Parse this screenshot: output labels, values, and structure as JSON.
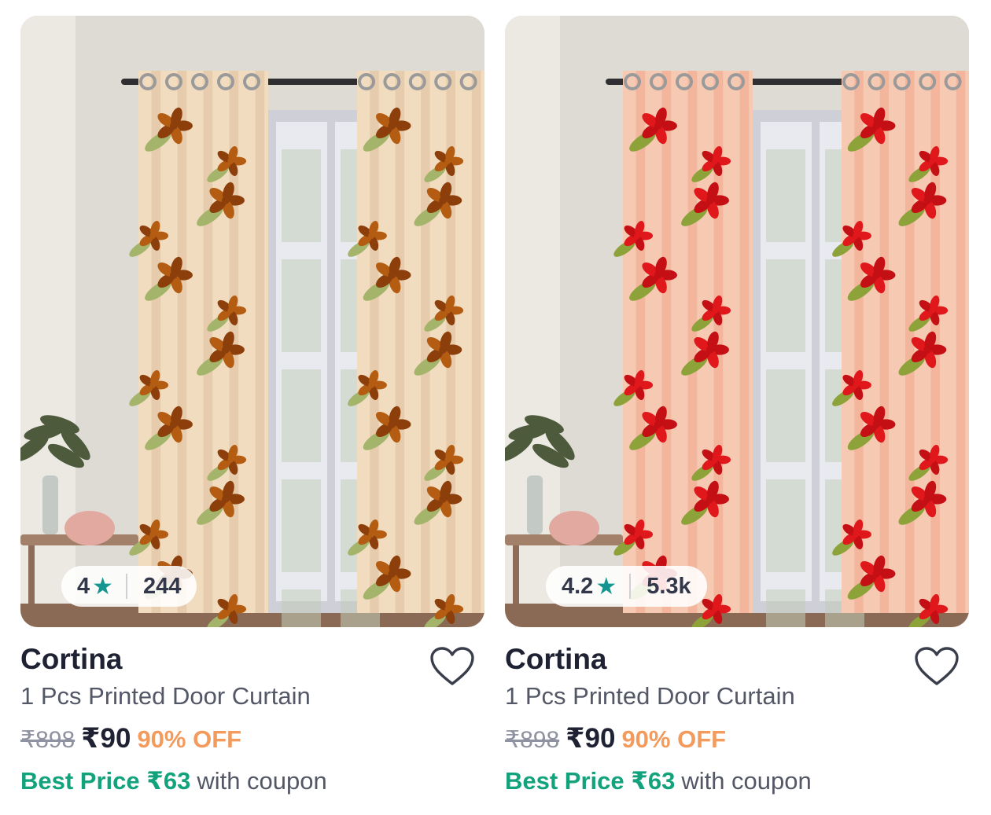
{
  "products": [
    {
      "rating": "4",
      "rating_count": "244",
      "brand": "Cortina",
      "title": "1 Pcs Printed Door Curtain",
      "mrp": "₹898",
      "price": "₹90",
      "discount": "90% OFF",
      "best_price_label": "Best Price ₹63",
      "best_price_suffix": "with coupon",
      "curtain_palette": {
        "base": "#f1dcc0",
        "shade": "#dcbf9a",
        "flower": "#b45d12",
        "flower2": "#8c3f0b",
        "leaf": "#a4b46a"
      },
      "wishlist_icon": "heart-outline-icon",
      "rating_icon": "star-icon"
    },
    {
      "rating": "4.2",
      "rating_count": "5.3k",
      "brand": "Cortina",
      "title": "1 Pcs Printed Door Curtain",
      "mrp": "₹898",
      "price": "₹90",
      "discount": "90% OFF",
      "best_price_label": "Best Price ₹63",
      "best_price_suffix": "with coupon",
      "curtain_palette": {
        "base": "#f6c9b3",
        "shade": "#f0a58a",
        "flower": "#e0181c",
        "flower2": "#c40f14",
        "leaf": "#8da33a"
      },
      "wishlist_icon": "heart-outline-icon",
      "rating_icon": "star-icon"
    }
  ],
  "colors": {
    "star": "#14958f",
    "best_price": "#12a37c",
    "discount": "#f39a5d",
    "mrp": "#8f92a0"
  }
}
